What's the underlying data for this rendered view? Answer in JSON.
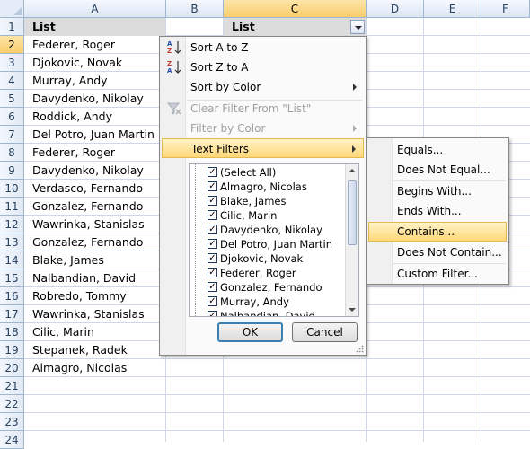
{
  "columns": [
    "A",
    "B",
    "C",
    "D",
    "E",
    "F"
  ],
  "rows": [
    "1",
    "2",
    "3",
    "4",
    "5",
    "6",
    "7",
    "8",
    "9",
    "10",
    "11",
    "12",
    "13",
    "14",
    "15",
    "16",
    "17",
    "18",
    "19",
    "20",
    "21",
    "22",
    "23",
    "24"
  ],
  "cells": {
    "A1": "List",
    "C1": "List",
    "A_values": [
      "Federer, Roger",
      "Djokovic, Novak",
      "Murray, Andy",
      "Davydenko, Nikolay",
      "Roddick, Andy",
      "Del Potro, Juan Martin",
      "Federer, Roger",
      "Davydenko, Nikolay",
      "Verdasco, Fernando",
      "Gonzalez, Fernando",
      "Wawrinka, Stanislas",
      "Gonzalez, Fernando",
      "Blake, James",
      "Nalbandian, David",
      "Robredo, Tommy",
      "Wawrinka, Stanislas",
      "Cilic, Marin",
      "Stepanek, Radek",
      "Almagro, Nicolas"
    ]
  },
  "filter_menu": {
    "sort_az": "Sort A to Z",
    "sort_za": "Sort Z to A",
    "sort_color": "Sort by Color",
    "clear_filter": "Clear Filter From \"List\"",
    "filter_color": "Filter by Color",
    "text_filters": "Text Filters",
    "items": [
      "(Select All)",
      "Almagro, Nicolas",
      "Blake, James",
      "Cilic, Marin",
      "Davydenko, Nikolay",
      "Del Potro, Juan Martin",
      "Djokovic, Novak",
      "Federer, Roger",
      "Gonzalez, Fernando",
      "Murray, Andy",
      "Nalbandian, David"
    ],
    "ok": "OK",
    "cancel": "Cancel"
  },
  "text_filters_submenu": {
    "equals": "Equals...",
    "not_equal": "Does Not Equal...",
    "begins_with": "Begins With...",
    "ends_with": "Ends With...",
    "contains": "Contains...",
    "not_contain": "Does Not Contain...",
    "custom": "Custom Filter..."
  }
}
